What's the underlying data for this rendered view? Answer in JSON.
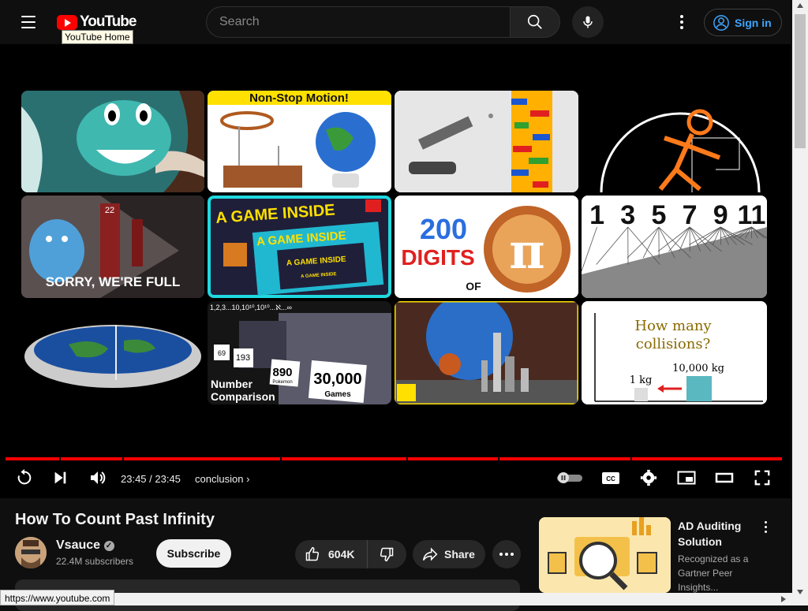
{
  "header": {
    "logo_text": "YouTube",
    "tooltip": "YouTube Home",
    "search_placeholder": "Search",
    "sign_in": "Sign in"
  },
  "grid": {
    "tiles": [
      {
        "name": "tile-cartoon-face"
      },
      {
        "name": "tile-non-stop-motion",
        "text": "Non-Stop  Motion!"
      },
      {
        "name": "tile-lego-tower"
      },
      {
        "name": "tile-golden-spiral"
      },
      {
        "name": "tile-hotel",
        "text": "SORRY, WE'RE FULL",
        "number": "22"
      },
      {
        "name": "tile-game-inside",
        "text1": "A GAME INSIDE",
        "text2": "A GAME INSIDE",
        "text3": "A GAME INSIDE",
        "text4": "A GAME INSIDE"
      },
      {
        "name": "tile-pi-digits",
        "text1": "200",
        "text2": "DIGITS",
        "text3": "OF",
        "text4": "π"
      },
      {
        "name": "tile-odd-numbers",
        "numbers": [
          "1",
          "3",
          "5",
          "7",
          "9",
          "11"
        ]
      },
      {
        "name": "tile-flat-earth"
      },
      {
        "name": "tile-number-comparison",
        "header": "1,2,3...10,10¹⁰,10¹⁰...ℵ...∞",
        "label1": "890",
        "label1_sub": "Pokemon",
        "label2": "30,000",
        "label2_sub": "Games",
        "label3": "193",
        "label4": "69",
        "caption1": "Number",
        "caption2": "Comparison"
      },
      {
        "name": "tile-planets-city"
      },
      {
        "name": "tile-collisions",
        "question1": "How many",
        "question2": "collisions?",
        "mass1": "1 kg",
        "mass2": "10,000 kg"
      }
    ]
  },
  "player": {
    "time": "23:45 / 23:45",
    "chapter": "conclusion"
  },
  "video": {
    "title": "How To Count Past Infinity",
    "channel": "Vsauce",
    "subscribers": "22.4M subscribers",
    "subscribe_label": "Subscribe",
    "likes": "604K",
    "share_label": "Share"
  },
  "ad": {
    "title": "AD Auditing Solution",
    "description": "Recognized as a Gartner Peer Insights..."
  },
  "status_bar": {
    "url": "https://www.youtube.com"
  },
  "colors": {
    "accent_red": "#ff0000",
    "link_blue": "#3ea6ff",
    "background": "#0f0f0f"
  }
}
